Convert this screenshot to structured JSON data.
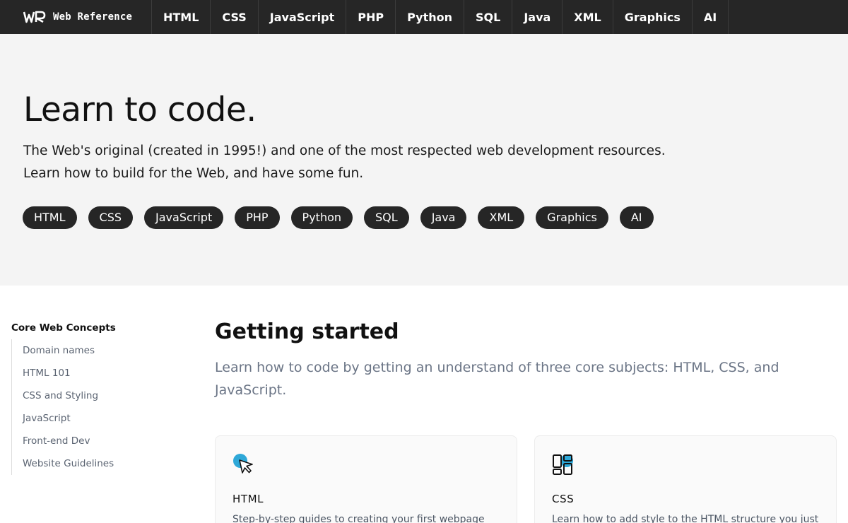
{
  "nav": {
    "brand": "Web Reference",
    "items": [
      {
        "label": "HTML"
      },
      {
        "label": "CSS"
      },
      {
        "label": "JavaScript"
      },
      {
        "label": "PHP"
      },
      {
        "label": "Python"
      },
      {
        "label": "SQL"
      },
      {
        "label": "Java"
      },
      {
        "label": "XML"
      },
      {
        "label": "Graphics"
      },
      {
        "label": "AI"
      }
    ]
  },
  "hero": {
    "title": "Learn to code.",
    "desc_line1": "The Web's original (created in 1995!) and one of the most respected web development resources.",
    "desc_line2": "Learn how to build for the Web, and have some fun.",
    "pills": [
      {
        "label": "HTML"
      },
      {
        "label": "CSS"
      },
      {
        "label": "JavaScript"
      },
      {
        "label": "PHP"
      },
      {
        "label": "Python"
      },
      {
        "label": "SQL"
      },
      {
        "label": "Java"
      },
      {
        "label": "XML"
      },
      {
        "label": "Graphics"
      },
      {
        "label": "AI"
      }
    ]
  },
  "sidebar": {
    "title": "Core Web Concepts",
    "items": [
      {
        "label": "Domain names"
      },
      {
        "label": "HTML 101"
      },
      {
        "label": "CSS and Styling"
      },
      {
        "label": "JavaScript"
      },
      {
        "label": "Front-end Dev"
      },
      {
        "label": "Website Guidelines"
      }
    ]
  },
  "main": {
    "title": "Getting started",
    "lead_line1": "Learn how to code by getting an understand of three core subjects: HTML, CSS, and",
    "lead_line2": "JavaScript.",
    "cards": [
      {
        "title": "HTML",
        "desc": "Step-by-step guides to creating your first webpage",
        "icon": "cursor-arrow-icon"
      },
      {
        "title": "CSS",
        "desc": "Learn how to add style to the HTML structure you just",
        "icon": "layout-blocks-icon"
      }
    ]
  },
  "colors": {
    "nav_bg": "#262626",
    "hero_bg": "#f4f4f4",
    "pill_bg": "#262626",
    "accent": "#2ea8d8",
    "muted_text": "#6b7586"
  }
}
